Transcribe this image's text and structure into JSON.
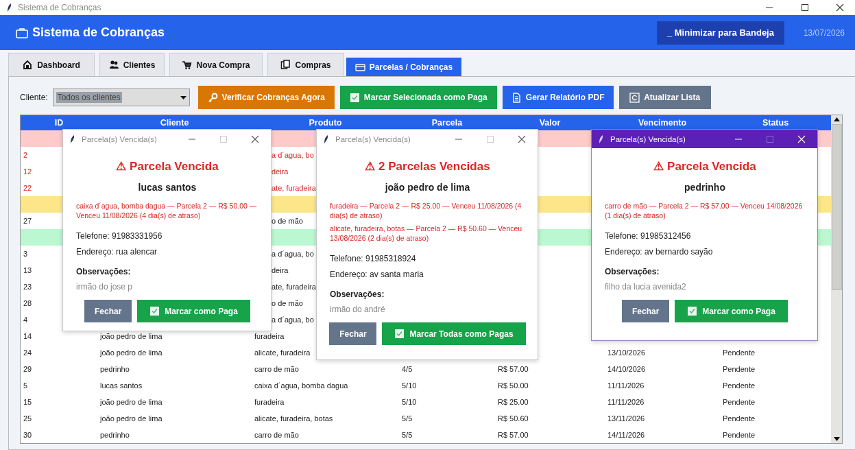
{
  "window": {
    "title": "Sistema de Cobranças"
  },
  "header": {
    "title": "Sistema de Cobranças",
    "tray_button": "_ Minimizar para Bandeja",
    "date": "13/07/2026"
  },
  "tabs": [
    {
      "label": "Dashboard",
      "selected": false
    },
    {
      "label": "Clientes",
      "selected": false
    },
    {
      "label": "Nova Compra",
      "selected": false
    },
    {
      "label": "Compras",
      "selected": false
    },
    {
      "label": "Parcelas / Cobranças",
      "selected": true
    }
  ],
  "toolbar": {
    "client_label": "Cliente:",
    "client_value": "Todos os clientes",
    "buttons": [
      {
        "label": "Verificar Cobranças Agora",
        "kind": "check"
      },
      {
        "label": "Marcar Selecionada como Paga",
        "kind": "pay"
      },
      {
        "label": "Gerar Relatório PDF",
        "kind": "report"
      },
      {
        "label": "Atualizar Lista",
        "kind": "refresh"
      }
    ]
  },
  "table": {
    "columns": [
      "ID",
      "Cliente",
      "Produto",
      "Parcela",
      "Valor",
      "Vencimento",
      "Status"
    ],
    "rows": [
      {
        "kind": "band",
        "color": "#fecaca"
      },
      {
        "kind": "data",
        "overdue": true,
        "clipped": true,
        "cells": {
          "id": "2",
          "product": "a d´agua, bo"
        }
      },
      {
        "kind": "data",
        "overdue": true,
        "clipped": true,
        "cells": {
          "id": "12",
          "product": "deira"
        }
      },
      {
        "kind": "data",
        "overdue": true,
        "clipped": true,
        "cells": {
          "id": "22",
          "product": "ate, furadeira"
        }
      },
      {
        "kind": "band",
        "color": "#fde68a"
      },
      {
        "kind": "data",
        "overdue": false,
        "clipped": true,
        "cells": {
          "id": "27",
          "product": "o de mão"
        }
      },
      {
        "kind": "band",
        "color": "#bbf7d0"
      },
      {
        "kind": "data",
        "overdue": false,
        "clipped": true,
        "cells": {
          "id": "3",
          "product": "a d´agua, bo"
        }
      },
      {
        "kind": "data",
        "overdue": false,
        "clipped": true,
        "cells": {
          "id": "13",
          "product": "deira"
        }
      },
      {
        "kind": "data",
        "overdue": false,
        "clipped": true,
        "cells": {
          "id": "23",
          "product": "ate, furadeira"
        }
      },
      {
        "kind": "data",
        "overdue": false,
        "clipped": true,
        "cells": {
          "id": "28",
          "product": "o de mão"
        }
      },
      {
        "kind": "data",
        "overdue": false,
        "clipped": true,
        "cells": {
          "id": "4",
          "product": "a d´agua, bo"
        }
      },
      {
        "kind": "data",
        "overdue": false,
        "clipped": false,
        "cells": {
          "id": "14",
          "client": "joão pedro de lima",
          "product": "furadeira"
        }
      },
      {
        "kind": "data",
        "overdue": false,
        "clipped": false,
        "cells": {
          "id": "24",
          "client": "joão pedro de lima",
          "product": "alicate, furadeira",
          "due": "13/10/2026",
          "status": "Pendente"
        }
      },
      {
        "kind": "data",
        "overdue": false,
        "clipped": false,
        "cells": {
          "id": "29",
          "client": "pedrinho",
          "product": "carro de mão",
          "parcel": "4/5",
          "value": "R$ 57.00",
          "due": "14/10/2026",
          "status": "Pendente"
        }
      },
      {
        "kind": "data",
        "overdue": false,
        "clipped": false,
        "cells": {
          "id": "5",
          "client": "lucas santos",
          "product": "caixa d´agua, bomba dagua",
          "parcel": "5/10",
          "value": "R$ 50.00",
          "due": "11/11/2026",
          "status": "Pendente"
        }
      },
      {
        "kind": "data",
        "overdue": false,
        "clipped": false,
        "cells": {
          "id": "15",
          "client": "joão pedro de lima",
          "product": "furadeira",
          "parcel": "5/10",
          "value": "R$ 25.00",
          "due": "11/11/2026",
          "status": "Pendente"
        }
      },
      {
        "kind": "data",
        "overdue": false,
        "clipped": false,
        "cells": {
          "id": "25",
          "client": "joão pedro de lima",
          "product": "alicate, furadeira, botas",
          "parcel": "5/5",
          "value": "R$ 50.60",
          "due": "13/11/2026",
          "status": "Pendente"
        }
      },
      {
        "kind": "data",
        "overdue": false,
        "clipped": false,
        "cells": {
          "id": "30",
          "client": "pedrinho",
          "product": "carro de mão",
          "parcel": "5/5",
          "value": "R$ 57.00",
          "due": "14/11/2026",
          "status": "Pendente"
        }
      }
    ]
  },
  "dialogs": [
    {
      "title": "Parcela(s) Vencida(s)",
      "active": false,
      "heading": "⚠ Parcela Vencida",
      "client": "lucas santos",
      "items": [
        "caixa d´agua, bomba dagua — Parcela 2 — R$ 50.00 — Venceu 11/08/2026  (4 dia(s) de atraso)"
      ],
      "phone": "Telefone: 91983331956",
      "address": "Endereço: rua alencar",
      "notes_label": "Observações:",
      "notes": "irmão do jose p",
      "buttons": [
        {
          "label": "Fechar",
          "kind": "close"
        },
        {
          "label": "Marcar como Paga",
          "kind": "pay"
        }
      ]
    },
    {
      "title": "Parcela(s) Vencida(s)",
      "active": false,
      "heading": "⚠ 2 Parcelas Vencidas",
      "client": "joão pedro de lima",
      "items": [
        "furadeira — Parcela 2 — R$ 25.00 — Venceu 11/08/2026  (4 dia(s) de atraso)",
        "alicate, furadeira, botas — Parcela 2 — R$ 50.60 — Venceu 13/08/2026  (2 dia(s) de atraso)"
      ],
      "phone": "Telefone: 91985318924",
      "address": "Endereço: av santa maria",
      "notes_label": "Observações:",
      "notes": "irmão do andré",
      "buttons": [
        {
          "label": "Fechar",
          "kind": "close"
        },
        {
          "label": "Marcar Todas como Pagas",
          "kind": "pay"
        }
      ]
    },
    {
      "title": "Parcela(s) Vencida(s)",
      "active": true,
      "heading": "⚠ Parcela Vencida",
      "client": "pedrinho",
      "items": [
        "carro de mão — Parcela 2 — R$ 57.00 — Venceu 14/08/2026  (1 dia(s) de atraso)"
      ],
      "phone": "Telefone: 91985312456",
      "address": "Endereço: av bernardo sayão",
      "notes_label": "Observações:",
      "notes": "filho da lucia avenida2",
      "buttons": [
        {
          "label": "Fechar",
          "kind": "close"
        },
        {
          "label": "Marcar como Paga",
          "kind": "pay"
        }
      ]
    }
  ]
}
